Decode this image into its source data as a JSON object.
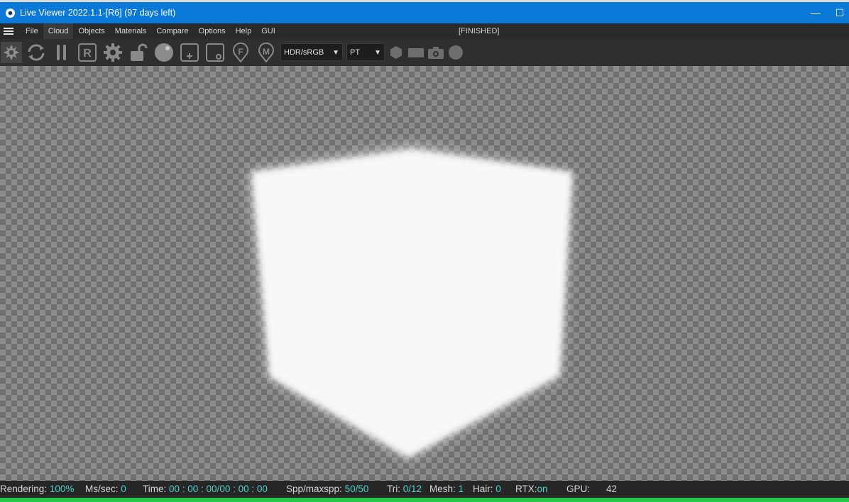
{
  "window": {
    "title": "Live Viewer 2022.1.1-[R6] (97 days left)",
    "minimize_glyph": "—",
    "maximize_glyph": "☐"
  },
  "menu": {
    "items": [
      "File",
      "Cloud",
      "Objects",
      "Materials",
      "Compare",
      "Options",
      "Help",
      "GUI"
    ],
    "active": "Cloud",
    "status": "[FINISHED]"
  },
  "toolbar": {
    "icons": [
      "shutter-icon",
      "refresh-icon",
      "pause-icon",
      "r-box-icon",
      "gear-icon",
      "unlock-icon",
      "sphere-icon",
      "add-box-icon",
      "object-box-icon",
      "f-pin-icon",
      "m-pin-icon",
      "hexagon-icon",
      "rectangle-icon",
      "camera-icon",
      "circle-icon"
    ],
    "r_letter": "R",
    "f_letter": "F",
    "m_letter": "M",
    "color_mode": "HDR/sRGB",
    "kernel": "PT"
  },
  "status": {
    "rendering_label": "Rendering:",
    "rendering_value": "100%",
    "ms_label": "Ms/sec:",
    "ms_value": "0",
    "time_label": "Time:",
    "time_value": "00 : 00 : 00/00 : 00 : 00",
    "spp_label": "Spp/maxspp:",
    "spp_value": "50/50",
    "tri_label": "Tri:",
    "tri_value": "0/12",
    "mesh_label": "Mesh:",
    "mesh_value": "1",
    "hair_label": "Hair:",
    "hair_value": "0",
    "rtx_label": "RTX:",
    "rtx_value": "on",
    "gpu_label": "GPU:",
    "gpu_value": "42"
  },
  "colors": {
    "titlebar": "#0a78d7",
    "accent_teal": "#52d1c6",
    "accent_green": "#55c25a",
    "progress_green": "#26c64a"
  }
}
